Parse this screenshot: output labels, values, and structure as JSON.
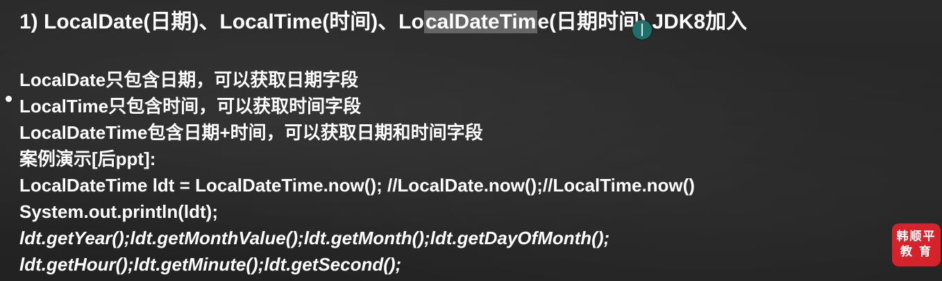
{
  "slide": {
    "title_before": "1) LocalDate(日期)、LocalTime(时间)、Lo",
    "title_highlight": "calDateTim",
    "title_after": "e(日期时间) JDK8加入",
    "lines": [
      "LocalDate只包含日期，可以获取日期字段",
      "LocalTime只包含时间，可以获取时间字段",
      "LocalDateTime包含日期+时间，可以获取日期和时间字段",
      "案例演示[后ppt]:",
      "LocalDateTime ldt = LocalDateTime.now(); //LocalDate.now();//LocalTime.now()",
      "System.out.println(ldt);",
      "ldt.getYear();ldt.getMonthValue();ldt.getMonth();ldt.getDayOfMonth();",
      "ldt.getHour();ldt.getMinute();ldt.getSecond();"
    ]
  },
  "logo": {
    "line1": "韩顺平",
    "line2": "教育",
    "color": "#d6232b"
  }
}
